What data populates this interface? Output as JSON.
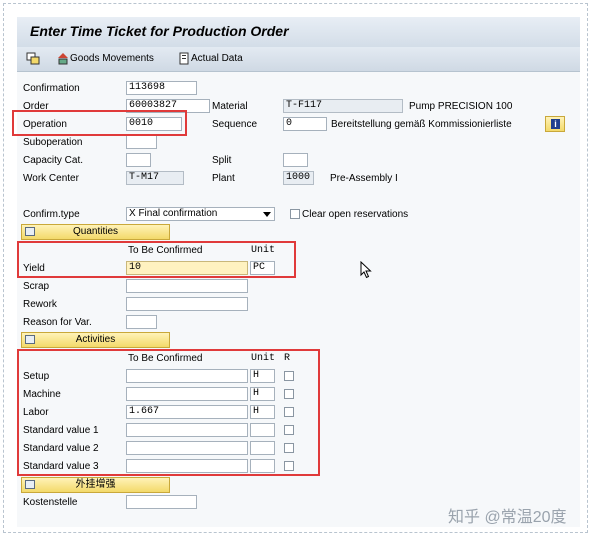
{
  "window": {
    "title": "Enter Time Ticket for Production Order"
  },
  "toolbar": {
    "goods_movements": "Goods Movements",
    "actual_data": "Actual Data"
  },
  "header": {
    "confirmation_label": "Confirmation",
    "confirmation_value": "113698",
    "order_label": "Order",
    "order_value": "60003827",
    "material_label": "Material",
    "material_value": "T-F117",
    "material_desc": "Pump PRECISION 100",
    "operation_label": "Operation",
    "operation_value": "0010",
    "sequence_label": "Sequence",
    "sequence_value": "0",
    "sequence_desc": "Bereitstellung gemäß Kommissionierliste",
    "suboperation_label": "Suboperation",
    "suboperation_value": "",
    "capacity_label": "Capacity Cat.",
    "capacity_value": "",
    "split_label": "Split",
    "split_value": "",
    "workcenter_label": "Work Center",
    "workcenter_value": "T-M17",
    "plant_label": "Plant",
    "plant_value": "1000",
    "plant_desc": "Pre-Assembly I"
  },
  "confirm": {
    "type_label": "Confirm.type",
    "type_value": "X Final confirmation",
    "clear_label": "Clear open reservations",
    "clear_checked": false
  },
  "quantities": {
    "tab_label": "Quantities",
    "col_confirm": "To Be Confirmed",
    "col_unit": "Unit",
    "rows": [
      {
        "label": "Yield",
        "value": "10",
        "unit": "PC"
      },
      {
        "label": "Scrap",
        "value": "",
        "unit": ""
      },
      {
        "label": "Rework",
        "value": "",
        "unit": ""
      },
      {
        "label": "Reason for Var.",
        "value": "",
        "unit": ""
      }
    ]
  },
  "activities": {
    "tab_label": "Activities",
    "col_confirm": "To Be Confirmed",
    "col_unit": "Unit",
    "col_r": "R",
    "rows": [
      {
        "label": "Setup",
        "value": "",
        "unit": "H"
      },
      {
        "label": "Machine",
        "value": "",
        "unit": "H"
      },
      {
        "label": "Labor",
        "value": "1.667",
        "unit": "H"
      },
      {
        "label": "Standard value 1",
        "value": "",
        "unit": ""
      },
      {
        "label": "Standard value 2",
        "value": "",
        "unit": ""
      },
      {
        "label": "Standard value 3",
        "value": "",
        "unit": ""
      }
    ]
  },
  "enhancement": {
    "tab_label": "外挂增强",
    "cost_center_label": "Kostenstelle",
    "cost_center_value": ""
  },
  "watermark": "知乎 @常温20度",
  "colors": {
    "highlight": "#e03a3a",
    "tab": "#f3d96a",
    "yield_bg": "#fff2c0"
  }
}
